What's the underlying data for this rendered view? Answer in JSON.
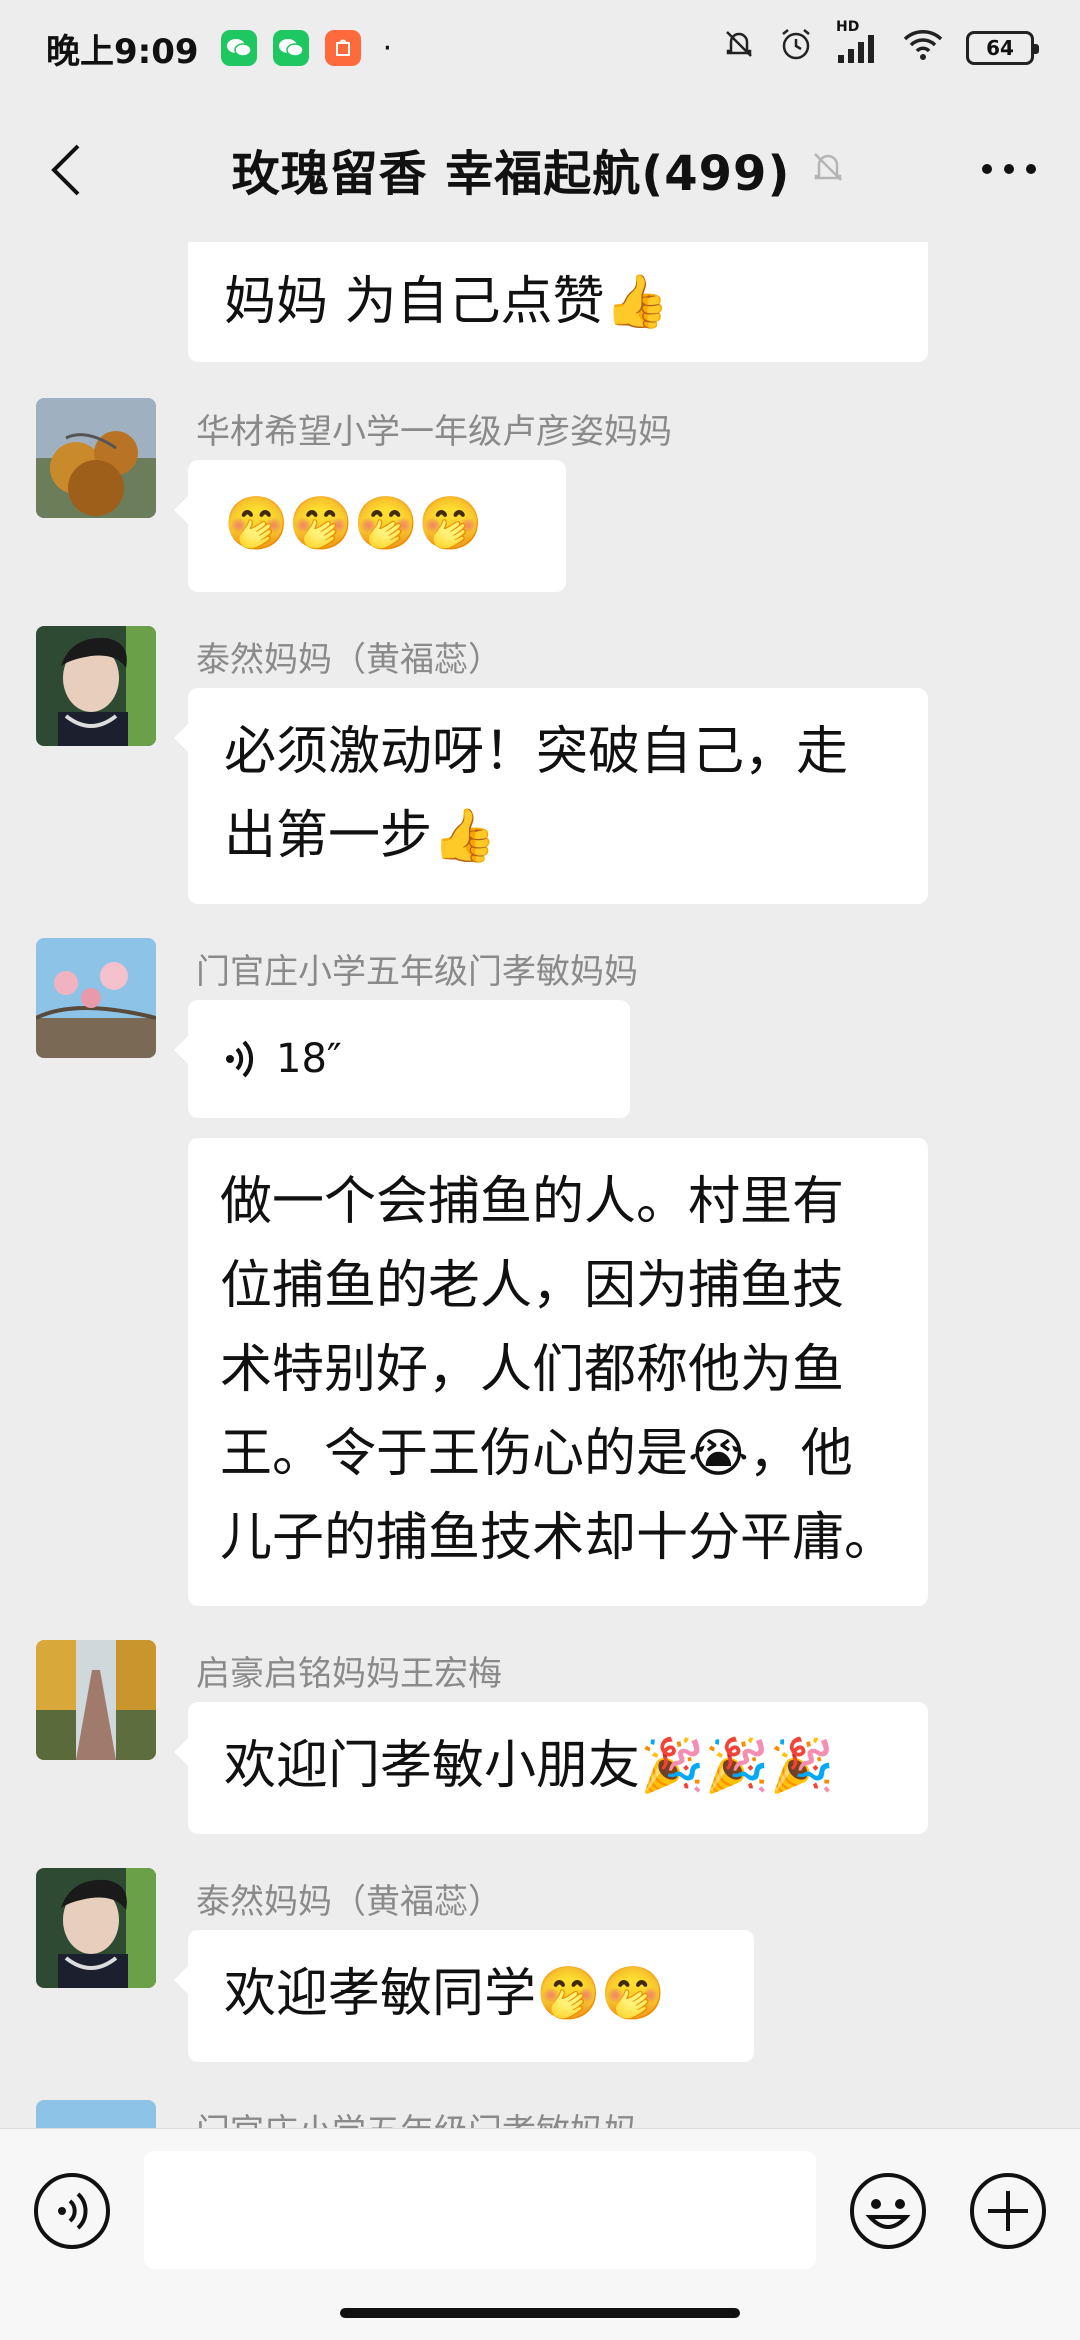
{
  "status": {
    "time": "晚上9:09",
    "apps": [
      "wechat-app",
      "wechat-app",
      "mi-app"
    ],
    "dot": "·",
    "network": "HD",
    "battery": "64"
  },
  "header": {
    "title": "玫瑰留香  幸福起航(499)"
  },
  "messages": [
    {
      "text": "妈妈  为自己点赞👍"
    },
    {
      "sender": "华材希望小学一年级卢彦姿妈妈",
      "text": "🤭🤭🤭🤭"
    },
    {
      "sender": "泰然妈妈（黄福蕊）",
      "line1": "必须激动呀！突破自己，走",
      "line2": "出第一步👍"
    },
    {
      "sender": "门官庄小学五年级门孝敏妈妈",
      "voice_duration": "18″"
    },
    {
      "line1": "做一个会捕鱼的人。村里有",
      "line2": "位捕鱼的老人，因为捕鱼技",
      "line3": "术特别好，人们都称他为鱼",
      "line4": "王。令于王伤心的是😭，他",
      "line5": "儿子的捕鱼技术却十分平庸。"
    },
    {
      "sender": "启豪启铭妈妈王宏梅",
      "text": "欢迎门孝敏小朋友🎉🎉🎉"
    },
    {
      "sender": "泰然妈妈（黄福蕊）",
      "text": "欢迎孝敏同学🤭🤭"
    },
    {
      "sender": "门官庄小学五年级门孝敏妈妈"
    }
  ],
  "colors": {
    "background": "#ededed",
    "bubble": "#ffffff",
    "sender": "#8a8a8a"
  }
}
